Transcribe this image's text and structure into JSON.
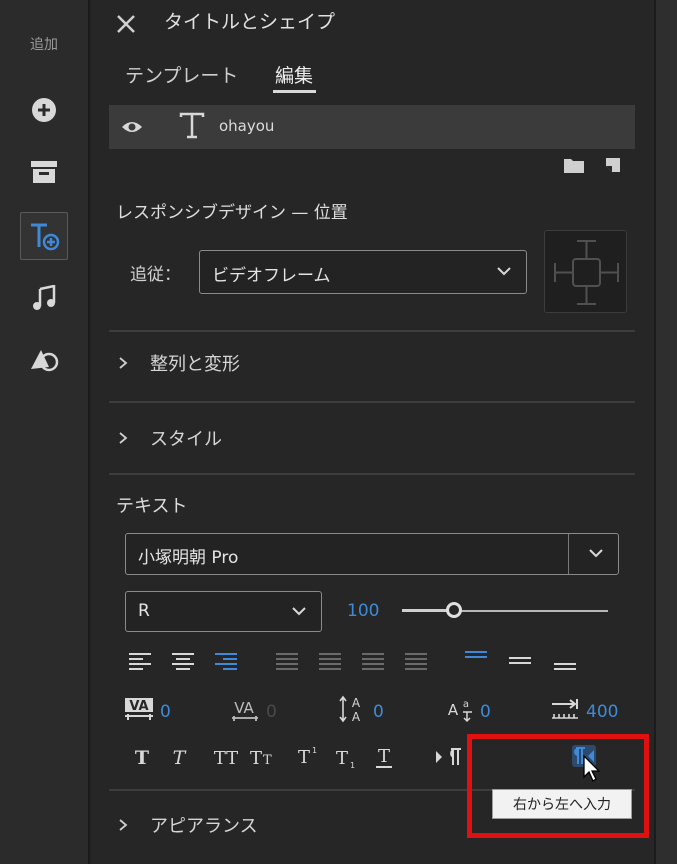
{
  "rail": {
    "label": "追加"
  },
  "header": {
    "title": "タイトルとシェイプ"
  },
  "tabs": [
    {
      "label": "テンプレート"
    },
    {
      "label": "編集"
    }
  ],
  "layer": {
    "name": "ohayou"
  },
  "responsive": {
    "title": "レスポンシブデザイン — 位置",
    "follow_label": "追従：",
    "follow_value": "ビデオフレーム"
  },
  "sections": {
    "align": "整列と変形",
    "style": "スタイル",
    "text": "テキスト",
    "appearance": "アピアランス"
  },
  "text": {
    "font": "小塚明朝  Pro",
    "font_style": "R",
    "size": "100",
    "size_slider_fraction": 0.25,
    "kerning": "0",
    "tracking": "0",
    "leading": "0",
    "baseline": "0",
    "tab_width": "400"
  },
  "tooltip": "右から左へ入力",
  "colors": {
    "accent": "#3f8ad8",
    "highlight": "#e01010"
  }
}
